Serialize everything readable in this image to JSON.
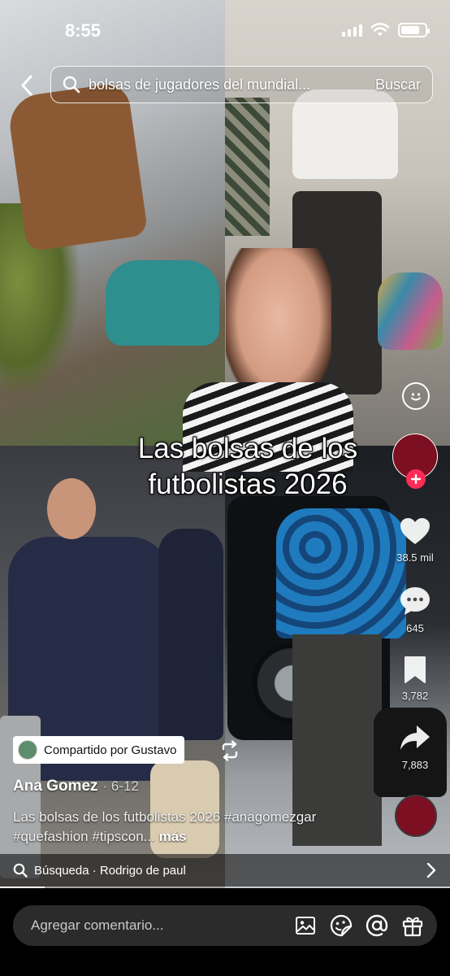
{
  "status_bar": {
    "time": "8:55",
    "battery_level": 0.8
  },
  "search": {
    "query": "bolsas de jugadores del mundial...",
    "submit_label": "Buscar"
  },
  "video": {
    "overlay_title": "Las bolsas de los futbolistas 2026",
    "progress": 0.1
  },
  "actions": {
    "likes": "38.5 mil",
    "comments": "645",
    "saves": "3,782",
    "shares": "7,883"
  },
  "post": {
    "shared_by": "Compartido por Gustavo",
    "author": "Ana Gomez",
    "date": "· 6-12",
    "description": "Las bolsas de los futbolistas 2026 #anagomezgar #quefashion #tipscon...",
    "more_label": "más"
  },
  "related_search": {
    "label": "Búsqueda · Rodrigo de paul"
  },
  "comment_bar": {
    "placeholder": "Agregar comentario..."
  },
  "icons": [
    "back-icon",
    "search-icon",
    "emoji-icon",
    "plus-icon",
    "heart-icon",
    "comment-icon",
    "bookmark-icon",
    "share-icon",
    "repost-icon",
    "chevron-right-icon",
    "image-icon",
    "sticker-icon",
    "mention-icon",
    "gift-icon"
  ],
  "colors": {
    "accent": "#fe2c55",
    "avatar": "#7d0f22",
    "comment_bar_bg": "#2b2b2b"
  }
}
